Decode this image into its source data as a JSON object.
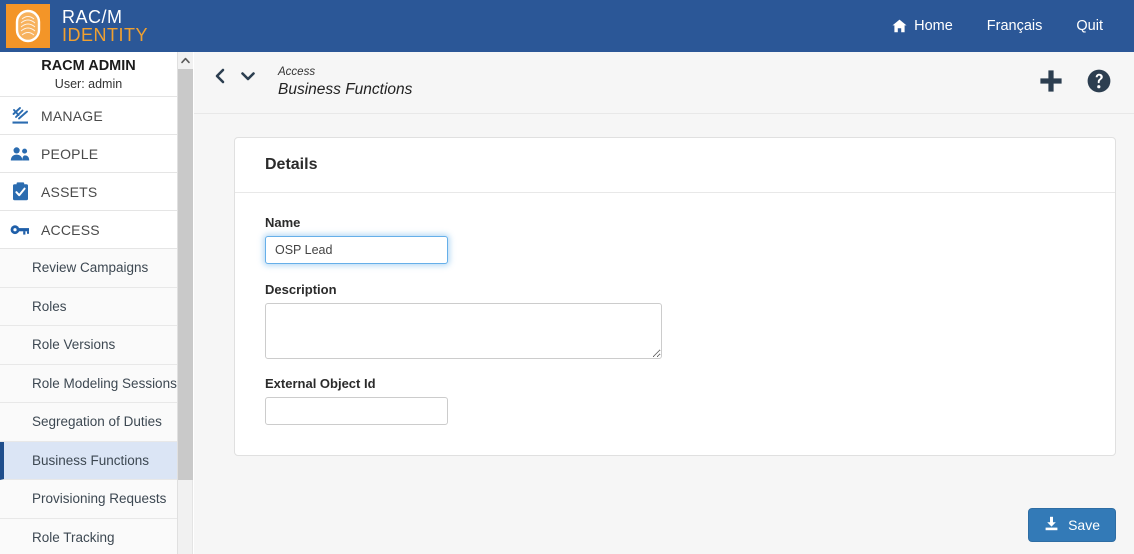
{
  "header": {
    "brand_line1": "RAC/M",
    "brand_line2": "IDENTITY",
    "logo_icon": "fingerprint-icon",
    "nav": [
      {
        "label": "Home",
        "icon": "home-icon"
      },
      {
        "label": "Français",
        "icon": ""
      },
      {
        "label": "Quit",
        "icon": ""
      }
    ]
  },
  "sidebar": {
    "user_name": "RACM ADMIN",
    "user_sub": "User: admin",
    "groups": [
      {
        "label": "MANAGE",
        "icon": "gavel-icon"
      },
      {
        "label": "PEOPLE",
        "icon": "people-icon"
      },
      {
        "label": "ASSETS",
        "icon": "clipboard-check-icon"
      },
      {
        "label": "ACCESS",
        "icon": "key-icon"
      }
    ],
    "subitems": [
      {
        "label": "Review Campaigns",
        "active": false
      },
      {
        "label": "Roles",
        "active": false
      },
      {
        "label": "Role Versions",
        "active": false
      },
      {
        "label": "Role Modeling Sessions",
        "active": false
      },
      {
        "label": "Segregation of Duties",
        "active": false
      },
      {
        "label": "Business Functions",
        "active": true
      },
      {
        "label": "Provisioning Requests",
        "active": false
      },
      {
        "label": "Role Tracking",
        "active": false
      }
    ]
  },
  "breadcrumb": {
    "parent": "Access",
    "current": "Business Functions",
    "back_icon": "chevron-left-icon",
    "dropdown_icon": "chevron-down-icon",
    "add_icon": "plus-icon",
    "help_icon": "question-circle-icon"
  },
  "panel": {
    "title": "Details",
    "fields": {
      "name": {
        "label": "Name",
        "value": "OSP Lead",
        "placeholder": ""
      },
      "description": {
        "label": "Description",
        "value": "",
        "placeholder": ""
      },
      "external_object_id": {
        "label": "External Object Id",
        "value": "",
        "placeholder": ""
      }
    }
  },
  "footer": {
    "save_label": "Save",
    "save_icon": "save-download-icon"
  },
  "colors": {
    "header_blue": "#2b5797",
    "brand_orange": "#f39528",
    "accent_blue": "#337ab7",
    "active_item_bg": "#dbe5f5",
    "active_item_border": "#1f4e8c"
  }
}
